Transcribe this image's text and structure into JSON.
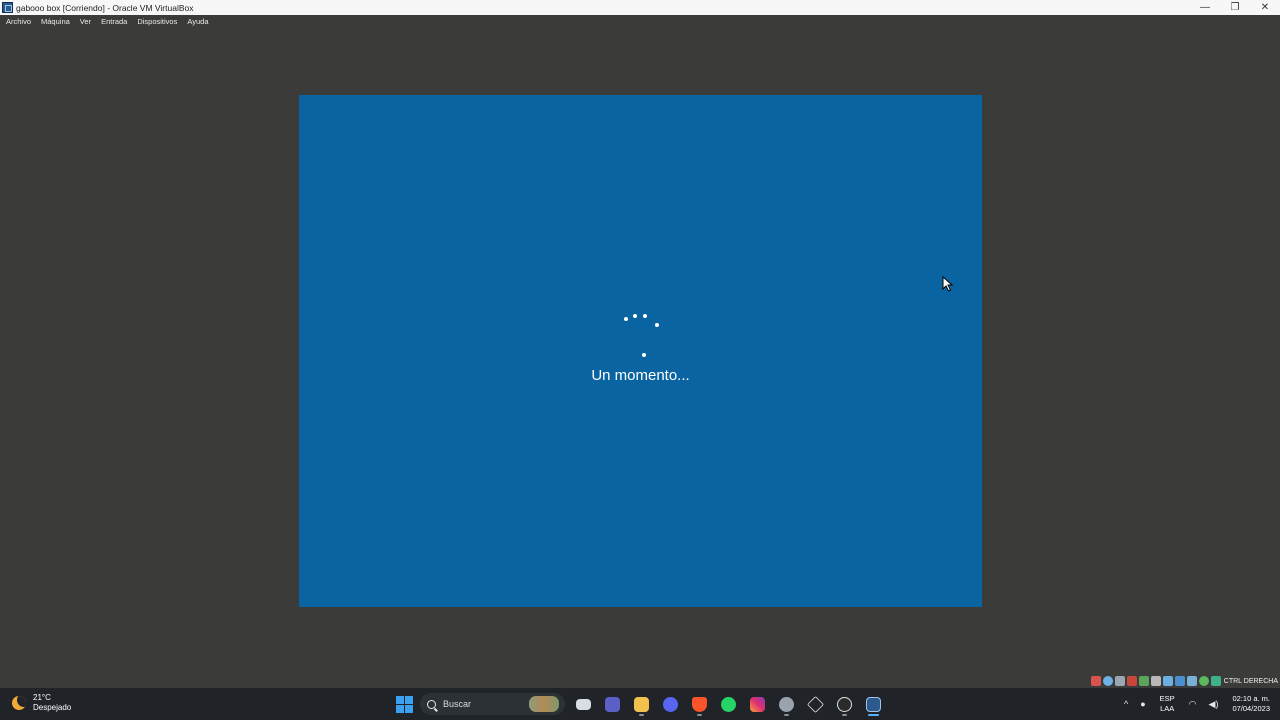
{
  "window": {
    "title": "gabooo box [Corriendo] - Oracle VM VirtualBox",
    "minimize_glyph": "—",
    "maximize_glyph": "❐",
    "close_glyph": "✕"
  },
  "menu": {
    "items": [
      "Archivo",
      "Máquina",
      "Ver",
      "Entrada",
      "Dispositivos",
      "Ayuda"
    ]
  },
  "vm": {
    "loading_text": "Un momento...",
    "background_color": "#0a64a2"
  },
  "status_bar": {
    "host_key_label": "CTRL DERECHA",
    "indicator_icons": [
      "hard-disk-icon",
      "optical-drive-icon",
      "audio-icon",
      "network-icon",
      "usb-icon",
      "shared-folders-icon",
      "display-icon",
      "video-capture-icon",
      "mouse-integration-icon",
      "keyboard-icon",
      "cpu-icon"
    ]
  },
  "taskbar": {
    "weather": {
      "temperature": "21°C",
      "condition": "Despejado"
    },
    "search_placeholder": "Buscar",
    "apps": [
      "task-view-icon",
      "teams-chat-icon",
      "file-explorer-icon",
      "discord-icon",
      "brave-icon",
      "whatsapp-icon",
      "instagram-icon",
      "settings-icon",
      "virtualbox-box-icon",
      "obs-icon",
      "virtualbox-icon"
    ],
    "tray": {
      "language_line1": "ESP",
      "language_line2": "LAA",
      "time": "02:10 a. m.",
      "date": "07/04/2023"
    }
  },
  "colors": {
    "accent": "#5ab0ff",
    "vm_background": "#0a64a2",
    "window_background": "#3b3c3a"
  }
}
